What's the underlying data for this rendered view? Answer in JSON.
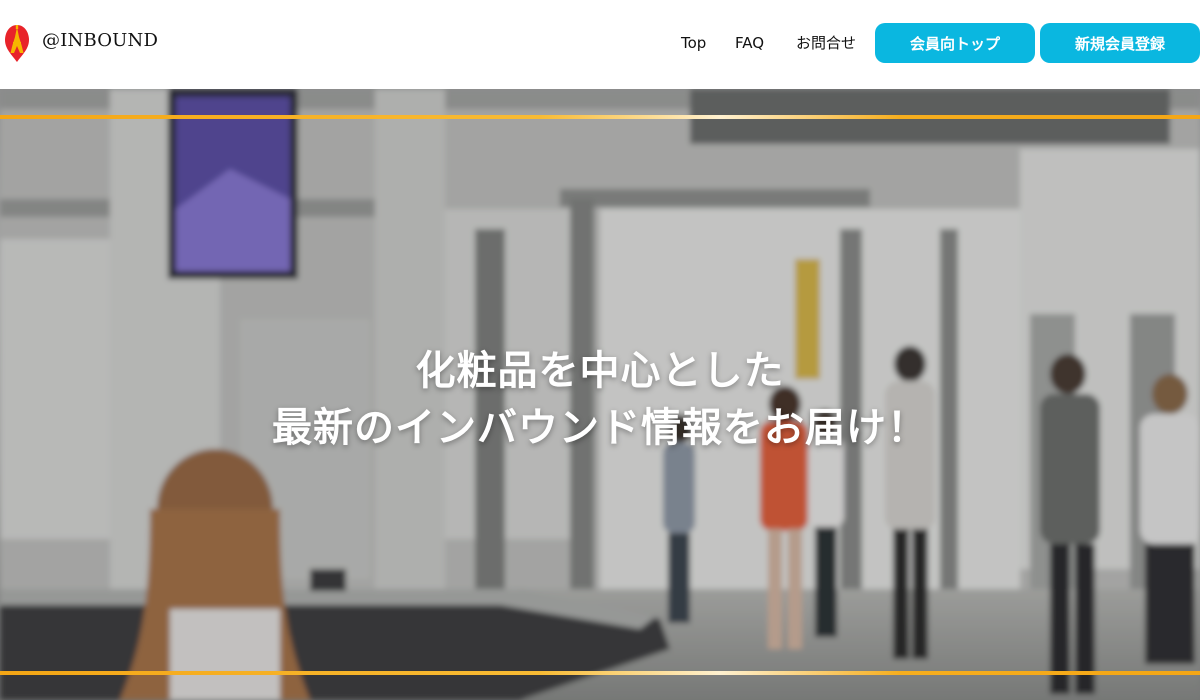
{
  "header": {
    "brand_name": "@INBOUND",
    "logo_icon": "eiffel-tower-pin-icon",
    "nav": {
      "top": "Top",
      "faq": "FAQ",
      "contact": "お問合せ"
    },
    "buttons": {
      "member_top": "会員向トップ",
      "register": "新規会員登録"
    }
  },
  "hero": {
    "headline_line1": "化粧品を中心とした",
    "headline_line2": "最新のインバウンド情報をお届け！",
    "background_image": "airport-terminal-photo"
  },
  "colors": {
    "accent": "#0ab7e0",
    "rule": "#f4a615",
    "logo_red": "#e8232a",
    "logo_yellow": "#f6b500"
  }
}
